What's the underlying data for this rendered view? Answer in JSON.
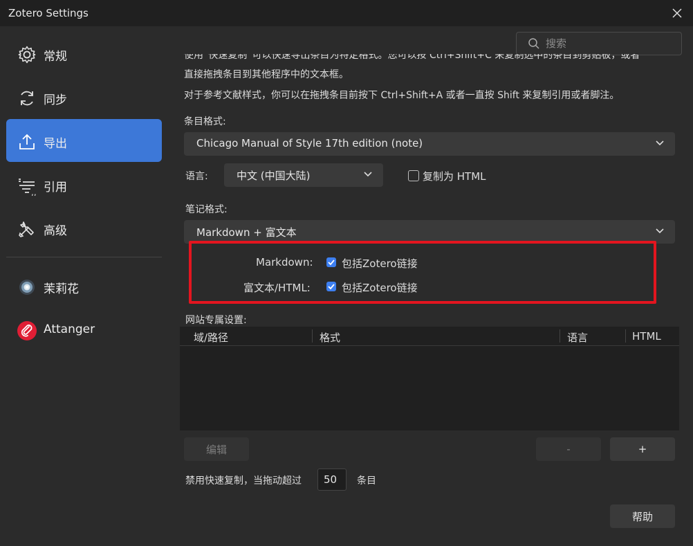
{
  "window": {
    "title": "Zotero Settings"
  },
  "search": {
    "placeholder": "搜索"
  },
  "sidebar": {
    "items": [
      {
        "label": "常规"
      },
      {
        "label": "同步"
      },
      {
        "label": "导出"
      },
      {
        "label": "引用"
      },
      {
        "label": "高级"
      }
    ],
    "plugins": [
      {
        "label": "茉莉花"
      },
      {
        "label": "Attanger"
      }
    ]
  },
  "export": {
    "desc_line1": "使用“快速复制”可以快速导出条目为特定格式。您可以按 Ctrl+Shift+C 来复制选中的条目到剪贴板，或者",
    "desc_line2": "直接拖拽条目到其他程序中的文本框。",
    "desc_line3": "对于参考文献样式，你可以在拖拽条目前按下 Ctrl+Shift+A 或者一直按 Shift 来复制引用或者脚注。",
    "item_format_label": "条目格式:",
    "item_format_value": "Chicago Manual of Style 17th edition (note)",
    "language_label": "语言:",
    "language_value": "中文 (中国大陆)",
    "copy_html_label": "复制为 HTML",
    "note_format_label": "笔记格式:",
    "note_format_value": "Markdown + 富文本",
    "markdown_label": "Markdown:",
    "markdown_include_links": "包括Zotero链接",
    "richtext_label": "富文本/HTML:",
    "richtext_include_links": "包括Zotero链接",
    "site_settings_label": "网站专属设置:",
    "table_headers": [
      "域/路径",
      "格式",
      "语言",
      "HTML"
    ],
    "edit_button": "编辑",
    "remove_button": "-",
    "add_button": "+",
    "disable_label": "禁用快速复制，当拖动超过",
    "disable_value": "50",
    "disable_unit": "条目",
    "help_button": "帮助"
  },
  "colors": {
    "accent": "#3d78d8",
    "highlight": "#e3151f"
  }
}
